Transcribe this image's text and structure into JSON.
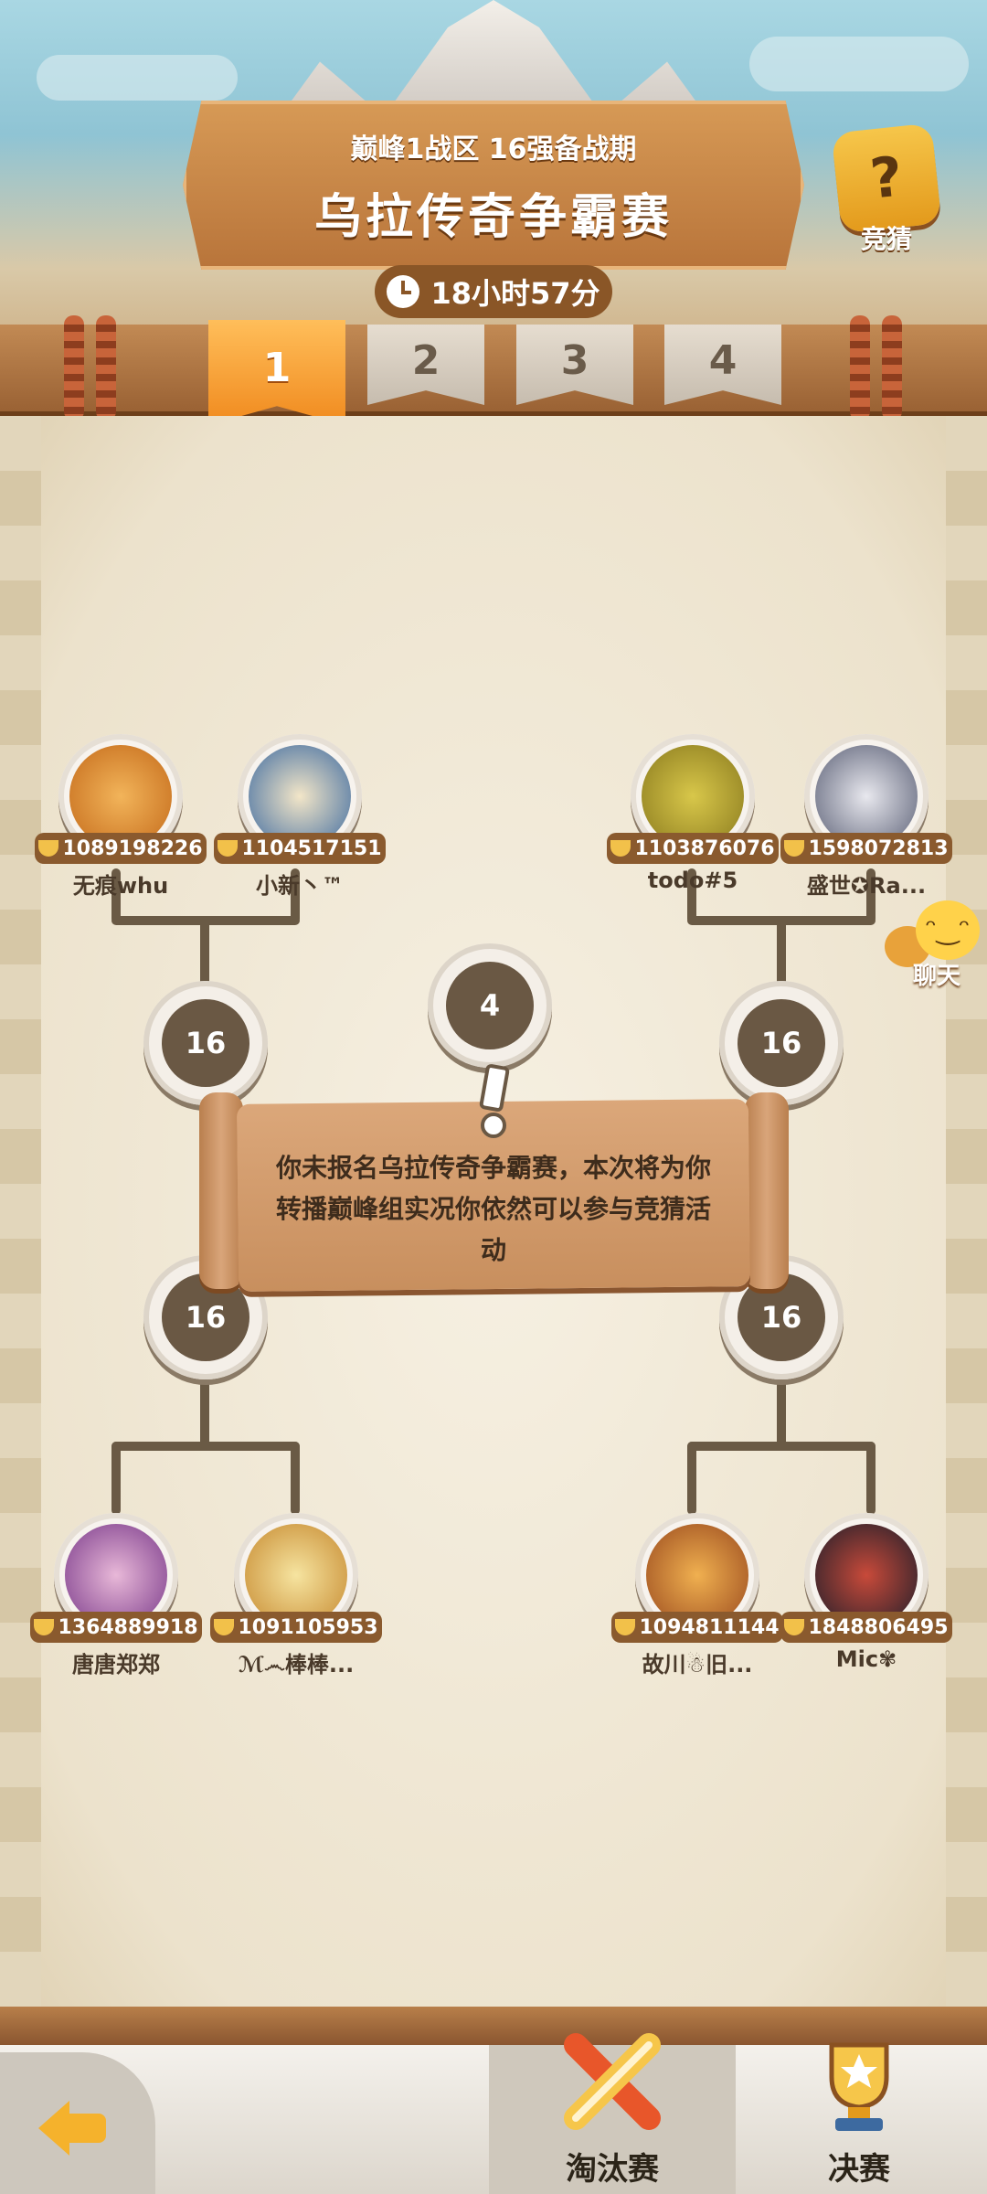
{
  "header": {
    "subtitle": "巅峰1战区 16强备战期",
    "title": "乌拉传奇争霸赛",
    "countdown": "18小时57分",
    "guess_label": "竞猜"
  },
  "round_tabs": [
    "1",
    "2",
    "3",
    "4"
  ],
  "active_round": "1",
  "players": {
    "top_left": [
      {
        "score": "1089198226",
        "name": "无痕whu",
        "color": "#d1842e"
      },
      {
        "score": "1104517151",
        "name": "小新丶™",
        "color": "#3d6aa0"
      }
    ],
    "top_right": [
      {
        "score": "1103876076",
        "name": "todo#5",
        "color": "#b8a13a"
      },
      {
        "score": "1598072813",
        "name": "盛世✪Ra...",
        "color": "#5a5f75"
      }
    ],
    "bottom_left": [
      {
        "score": "1364889918",
        "name": "唐唐郑郑",
        "color": "#7a3a8a"
      },
      {
        "score": "1091105953",
        "name": "ℳ෴棒棒...",
        "color": "#c6892f"
      }
    ],
    "bottom_right": [
      {
        "score": "1094811144",
        "name": "故川☃旧...",
        "color": "#9a4a1e"
      },
      {
        "score": "1848806495",
        "name": "Mic✾",
        "color": "#2a2a3a"
      }
    ]
  },
  "nodes": {
    "final": "4",
    "left_top": "16",
    "right_top": "16",
    "left_bottom": "16",
    "right_bottom": "16"
  },
  "notice": "你未报名乌拉传奇争霸赛，本次将为你转播巅峰组实况你依然可以参与竞猜活动",
  "chat_label": "聊天",
  "bottom_nav": {
    "knockout_label": "淘汰赛",
    "final_label": "决赛"
  },
  "icons": {
    "guess": "question-thumb-icon",
    "clock": "clock-icon",
    "back": "back-arrow-icon",
    "chat": "chat-bubble-icon",
    "knockout": "crossed-swords-icon",
    "final": "trophy-icon",
    "coin": "coin-icon"
  }
}
